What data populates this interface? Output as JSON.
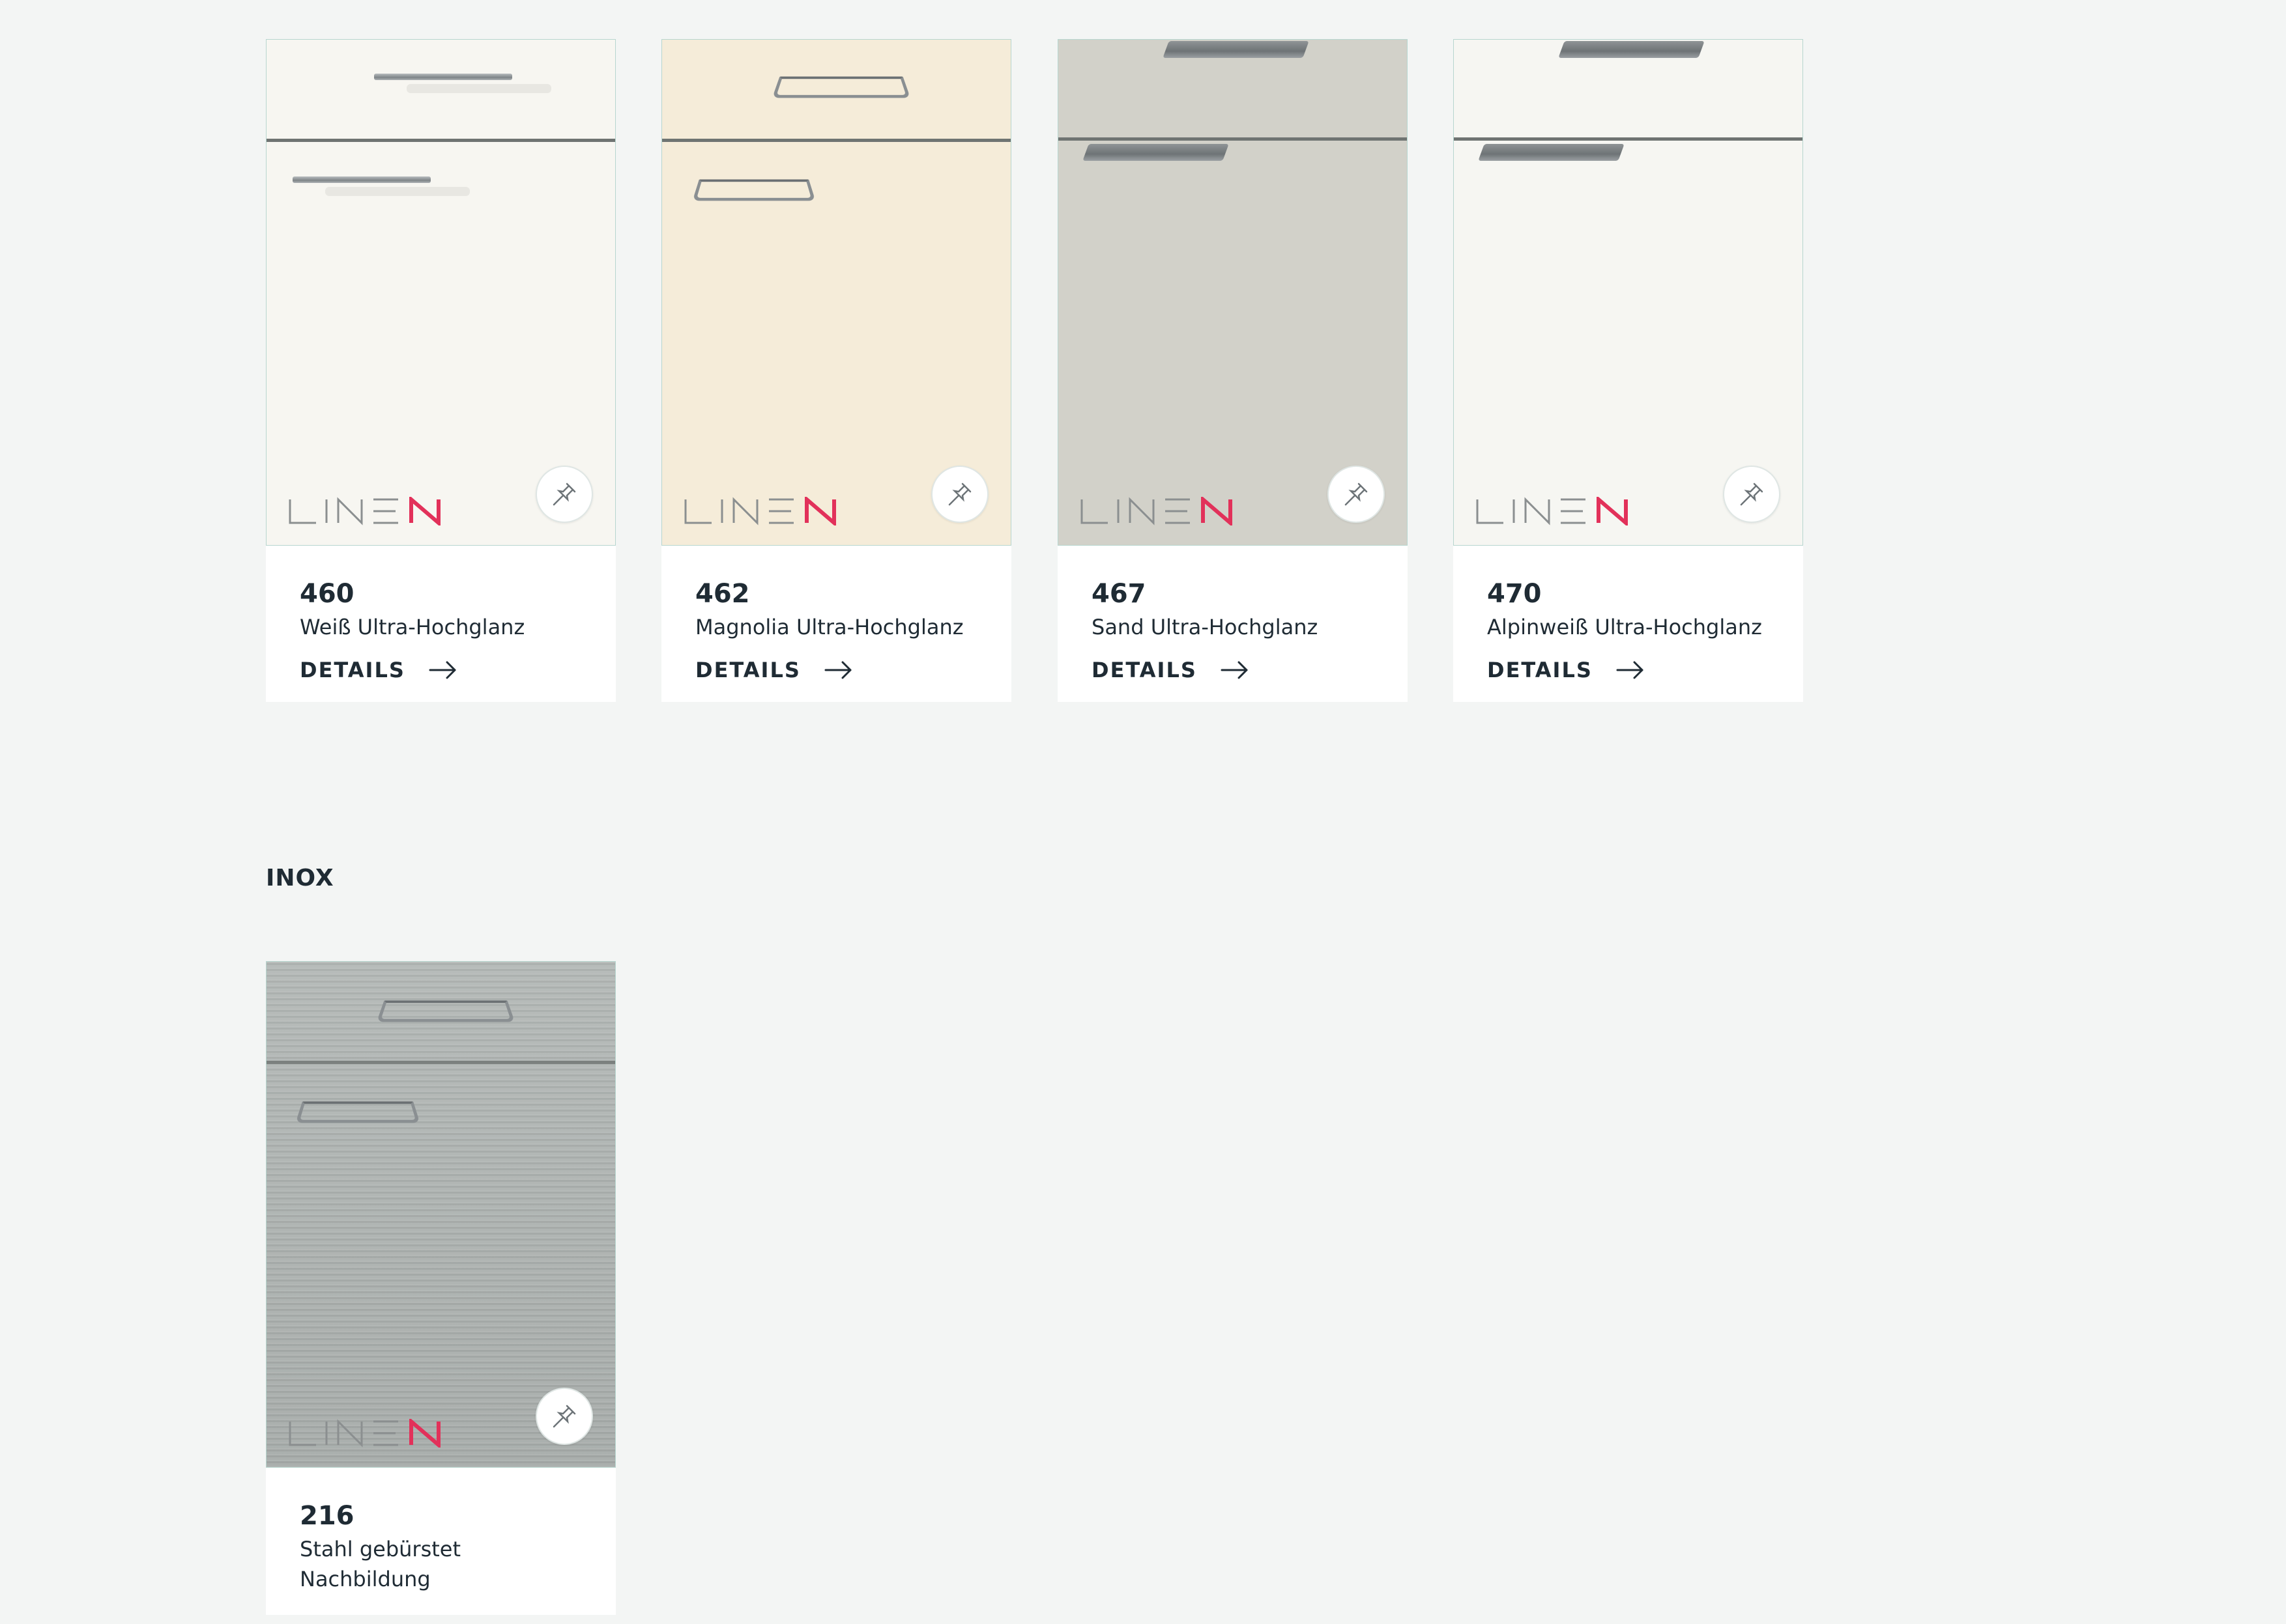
{
  "products": [
    {
      "number": "460",
      "name": "Weiß Ultra-Hochglanz",
      "details": "DETAILS",
      "logo": "LINE N",
      "color": "#f7f6f1"
    },
    {
      "number": "462",
      "name": "Magnolia Ultra-Hochglanz",
      "details": "DETAILS",
      "logo": "LINE N",
      "color": "#f5ecd9"
    },
    {
      "number": "467",
      "name": "Sand Ultra-Hochglanz",
      "details": "DETAILS",
      "logo": "LINE N",
      "color": "#d2d1c9"
    },
    {
      "number": "470",
      "name": "Alpinweiß Ultra-Hochglanz",
      "details": "DETAILS",
      "logo": "LINE N",
      "color": "#f6f6f2"
    }
  ],
  "inox_section": {
    "heading": "INOX",
    "products": [
      {
        "number": "216",
        "name_line1": "Stahl gebürstet",
        "name_line2": "Nachbildung",
        "logo": "LINE N",
        "color": "#abb0ae"
      }
    ]
  },
  "icons": {
    "pin": "pin-icon",
    "arrow": "arrow-right-icon"
  },
  "accent_logo_color": "#e2315a"
}
